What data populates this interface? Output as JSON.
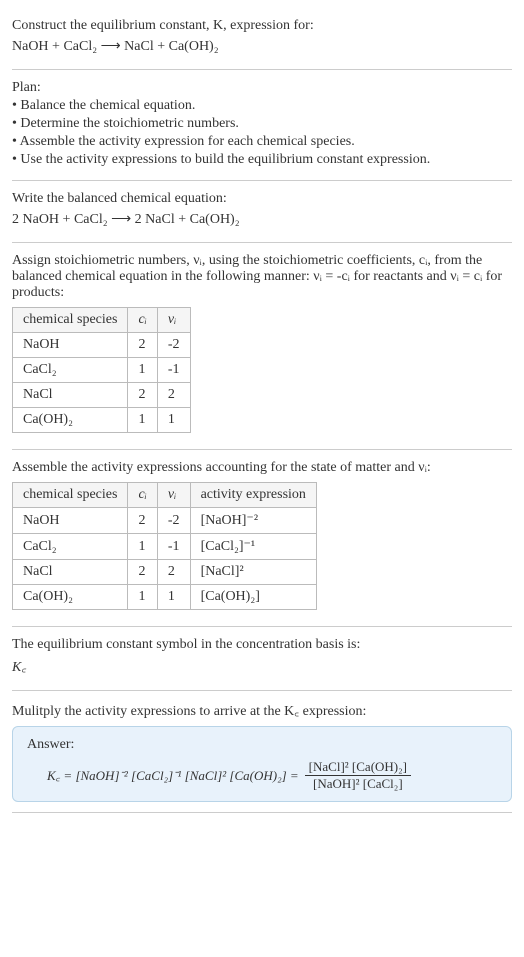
{
  "s1": {
    "intro": "Construct the equilibrium constant, K, expression for:",
    "eq": "NaOH + CaCl₂ ⟶ NaCl + Ca(OH)₂"
  },
  "s2": {
    "plan": "Plan:",
    "b1": "• Balance the chemical equation.",
    "b2": "• Determine the stoichiometric numbers.",
    "b3": "• Assemble the activity expression for each chemical species.",
    "b4": "• Use the activity expressions to build the equilibrium constant expression."
  },
  "s3": {
    "t": "Write the balanced chemical equation:",
    "eq": "2 NaOH + CaCl₂ ⟶ 2 NaCl + Ca(OH)₂"
  },
  "s4": {
    "t1": "Assign stoichiometric numbers, νᵢ, using the stoichiometric coefficients, cᵢ, from the balanced chemical equation in the following manner: νᵢ = -cᵢ for reactants and νᵢ = cᵢ for products:",
    "h1": "chemical species",
    "h2": "cᵢ",
    "h3": "νᵢ",
    "r": [
      {
        "a": "NaOH",
        "b": "2",
        "c": "-2"
      },
      {
        "a": "CaCl₂",
        "b": "1",
        "c": "-1"
      },
      {
        "a": "NaCl",
        "b": "2",
        "c": "2"
      },
      {
        "a": "Ca(OH)₂",
        "b": "1",
        "c": "1"
      }
    ]
  },
  "s5": {
    "t": "Assemble the activity expressions accounting for the state of matter and νᵢ:",
    "h1": "chemical species",
    "h2": "cᵢ",
    "h3": "νᵢ",
    "h4": "activity expression",
    "r": [
      {
        "a": "NaOH",
        "b": "2",
        "c": "-2",
        "d": "[NaOH]⁻²"
      },
      {
        "a": "CaCl₂",
        "b": "1",
        "c": "-1",
        "d": "[CaCl₂]⁻¹"
      },
      {
        "a": "NaCl",
        "b": "2",
        "c": "2",
        "d": "[NaCl]²"
      },
      {
        "a": "Ca(OH)₂",
        "b": "1",
        "c": "1",
        "d": "[Ca(OH)₂]"
      }
    ]
  },
  "s6": {
    "t": "The equilibrium constant symbol in the concentration basis is:",
    "sym": "K꜀"
  },
  "s7": {
    "t": "Mulitply the activity expressions to arrive at the K꜀ expression:"
  },
  "ans": {
    "label": "Answer:",
    "lhs": "K꜀ = [NaOH]⁻² [CaCl₂]⁻¹ [NaCl]² [Ca(OH)₂] =",
    "num": "[NaCl]² [Ca(OH)₂]",
    "den": "[NaOH]² [CaCl₂]"
  },
  "chart_data": {
    "type": "table",
    "title": "Stoichiometric numbers and activity expressions",
    "columns": [
      "chemical species",
      "c_i",
      "ν_i",
      "activity expression"
    ],
    "rows": [
      [
        "NaOH",
        2,
        -2,
        "[NaOH]^-2"
      ],
      [
        "CaCl2",
        1,
        -1,
        "[CaCl2]^-1"
      ],
      [
        "NaCl",
        2,
        2,
        "[NaCl]^2"
      ],
      [
        "Ca(OH)2",
        1,
        1,
        "[Ca(OH)2]"
      ]
    ]
  }
}
